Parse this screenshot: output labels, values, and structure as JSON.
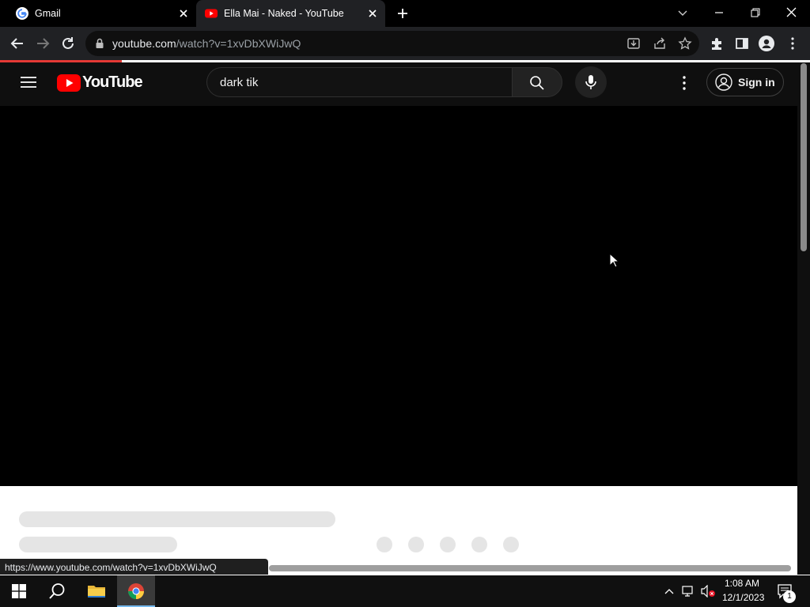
{
  "browser": {
    "tabs": [
      {
        "title": "Gmail",
        "favicon": "google-g-icon",
        "active": false
      },
      {
        "title": "Ella Mai - Naked - YouTube",
        "favicon": "youtube-icon",
        "active": true
      }
    ],
    "url_host": "youtube.com",
    "url_path": "/watch?v=1xvDbXWiJwQ",
    "status_url": "https://www.youtube.com/watch?v=1xvDbXWiJwQ",
    "loading_progress": 0.15
  },
  "youtube": {
    "logo_text": "YouTube",
    "search_value": "dark tik",
    "sign_in_label": "Sign in"
  },
  "taskbar": {
    "time": "1:08 AM",
    "date": "12/1/2023",
    "notification_count": "1"
  },
  "colors": {
    "accent_red": "#ff0000",
    "header_bg": "#0f0f0f",
    "chrome_bg": "#202124"
  }
}
